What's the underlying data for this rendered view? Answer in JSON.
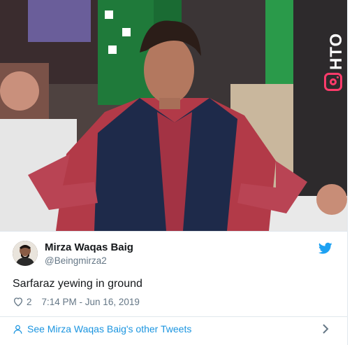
{
  "media": {
    "watermark_text": "HTO",
    "instagram_icon": "instagram-icon"
  },
  "tweet": {
    "display_name": "Mirza Waqas Baig",
    "handle": "@Beingmirza2",
    "text": "Sarfaraz yewing in ground",
    "likes": "2",
    "timestamp": "7:14 PM - Jun 16, 2019",
    "footer_link": "See Mirza Waqas Baig's other Tweets"
  },
  "icons": {
    "logo": "twitter-bird-icon",
    "like": "heart-icon",
    "profile": "person-icon",
    "more": "chevron-right-icon"
  },
  "colors": {
    "link": "#1b95e0",
    "brand": "#1da1f2",
    "secondary_text": "#657786",
    "primary_text": "#14171a",
    "border": "#e1e8ed"
  }
}
